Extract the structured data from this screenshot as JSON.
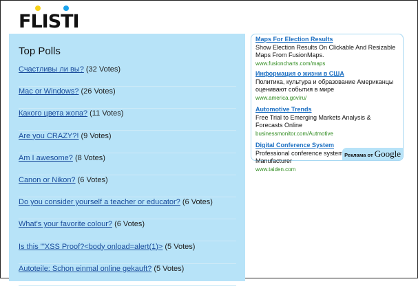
{
  "logo": {
    "text": "FLISTI",
    "dot_colors": [
      "#f7d117",
      "#1aa3ec"
    ]
  },
  "polls": {
    "title": "Top Polls",
    "items": [
      {
        "q": "Счастливы ли вы?",
        "v": "(32 Votes)"
      },
      {
        "q": "Mac or Windows?",
        "v": "(26 Votes)"
      },
      {
        "q": "Какого цвета жопа?",
        "v": "(11 Votes)"
      },
      {
        "q": "Are you CRAZY?!",
        "v": "(9 Votes)"
      },
      {
        "q": "Am I awesome?",
        "v": "(8 Votes)"
      },
      {
        "q": "Canon or Nikon?",
        "v": "(6 Votes)"
      },
      {
        "q": "Do you consider yourself a teacher or educator?",
        "v": "(6 Votes)"
      },
      {
        "q": "What's your favorite colour?",
        "v": "(6 Votes)"
      },
      {
        "q": "Is this '\"XSS Proof?<body onload=alert(1)>",
        "v": "(5 Votes)"
      },
      {
        "q": "Autoteile: Schon einmal online gekauft?",
        "v": "(5 Votes)"
      }
    ]
  },
  "ads": {
    "items": [
      {
        "title": "Maps For Election Results",
        "desc": "Show Election Results On Clickable And Resizable Maps From FusionMaps.",
        "url": "www.fusioncharts.com/maps"
      },
      {
        "title": "Информация о жизни в США",
        "desc": "Политика, культура и образование Американцы оценивают события в мире",
        "url": "www.america.gov/ru/"
      },
      {
        "title": "Automotive Trends",
        "desc": "Free Trial to Emerging Markets Analysis & Forecasts Online",
        "url": "businessmonitor.com/Autmotive"
      },
      {
        "title": "Digital Conference System",
        "desc": "Professional conference system World Advanced Manufacturer",
        "url": "www.taiden.com"
      }
    ],
    "badge": "Реклама от",
    "badge_brand": "Google"
  }
}
